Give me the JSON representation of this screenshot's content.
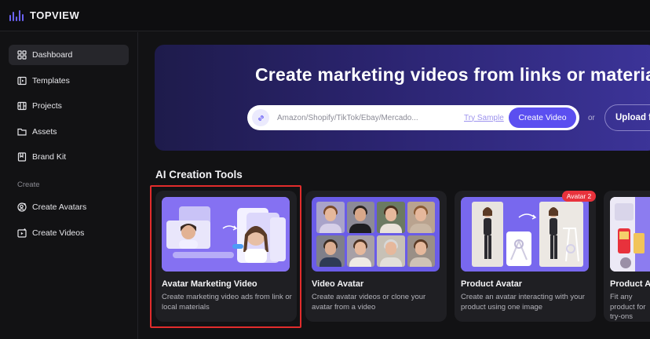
{
  "brand": {
    "name": "TOPVIEW",
    "accent": "#6b63f5"
  },
  "sidebar": {
    "items": [
      {
        "label": "Dashboard",
        "icon": "grid-icon",
        "active": true
      },
      {
        "label": "Templates",
        "icon": "template-icon"
      },
      {
        "label": "Projects",
        "icon": "projects-icon"
      },
      {
        "label": "Assets",
        "icon": "folder-icon"
      },
      {
        "label": "Brand Kit",
        "icon": "bookmark-icon"
      }
    ],
    "section_create": "Create",
    "create_items": [
      {
        "label": "Create Avatars",
        "icon": "avatar-add-icon"
      },
      {
        "label": "Create Videos",
        "icon": "video-add-icon"
      }
    ]
  },
  "hero": {
    "title": "Create marketing videos from links or materials",
    "search_placeholder": "Amazon/Shopify/TikTok/Ebay/Mercado...",
    "try_sample": "Try Sample",
    "create_button": "Create Video",
    "or": "or",
    "upload_button": "Upload files"
  },
  "tools": {
    "section_title": "AI Creation Tools",
    "cards": [
      {
        "title": "Avatar Marketing Video",
        "desc": "Create marketing video ads from link or local materials",
        "selected": true
      },
      {
        "title": "Video Avatar",
        "desc": "Create avatar videos or clone your avatar from a video"
      },
      {
        "title": "Product Avatar",
        "desc": "Create an avatar interacting with your product using one image",
        "badge": "Avatar 2"
      },
      {
        "title": "Product Avatar",
        "desc": "Fit any product for try-ons"
      }
    ]
  },
  "colors": {
    "highlight": "#e22c2c",
    "badge": "#e8323c",
    "button": "#5b4ff0"
  }
}
